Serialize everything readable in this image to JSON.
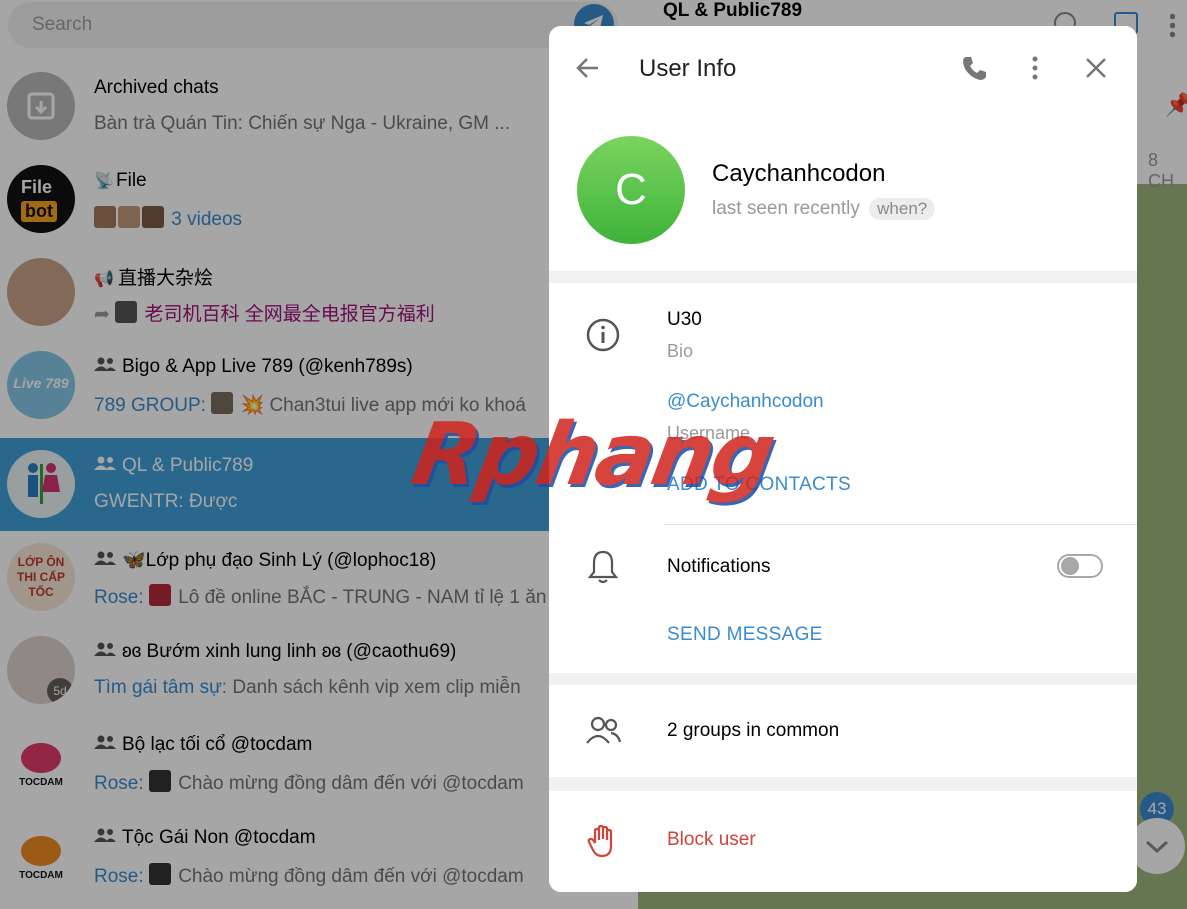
{
  "search": {
    "placeholder": "Search"
  },
  "chats": [
    {
      "title": "Archived chats",
      "subtitle": "Bàn trà Quán Tin: Chiến sự Nga - Ukraine, GM ...",
      "avatar": "archive-icon"
    },
    {
      "title": "File",
      "title_prefix_icon": "channel-icon",
      "subtitle": "3 videos",
      "avatar_text": [
        "File",
        "bot"
      ]
    },
    {
      "title": "直播大杂烩",
      "title_prefix_icon": "megaphone-icon",
      "subtitle": "老司机百科 全网最全电报官方福利"
    },
    {
      "title": "Bigo & App Live 789 (@kenh789s)",
      "sender": "789 GROUP:",
      "subtitle": "Chan3tui live app mới ko khoá",
      "avatar_text": [
        "Live 789"
      ]
    },
    {
      "title": "QL & Public789",
      "sender": "GWENTR:",
      "subtitle": "Được",
      "active": true
    },
    {
      "title": "🦋Lớp phụ đạo Sinh Lý (@lophoc18)",
      "sender": "Rose:",
      "subtitle": "Lô đề online BẮC - TRUNG - NAM tỉ lệ 1 ăn",
      "avatar_text": [
        "LỚP ÔN",
        "THI CẤP",
        "TỐC"
      ]
    },
    {
      "title": "ʚɞ Bướm xinh lung linh ʚɞ (@caothu69)",
      "sender": "Tìm gái tâm sự:",
      "subtitle": "Danh sách kênh vip xem clip miễn",
      "avatar_badge": "5d"
    },
    {
      "title": "Bộ lạc tối cổ @tocdam",
      "sender": "Rose:",
      "subtitle": "Chào mừng đồng dâm đến với @tocdam",
      "avatar_text": [
        "TOCDAM"
      ]
    },
    {
      "title": "Tộc Gái Non @tocdam",
      "sender": "Rose:",
      "subtitle": "Chào mừng đồng dâm đến với @tocdam",
      "avatar_text": [
        "TOCDAM"
      ]
    }
  ],
  "right_panel": {
    "title": "QL & Public789",
    "pinned_time": "8 CH",
    "unread_count": "43"
  },
  "modal": {
    "title": "User Info",
    "avatar_letter": "C",
    "name": "Caychanhcodon",
    "status": "last seen recently",
    "when_label": "when?",
    "bio_value": "U30",
    "bio_label": "Bio",
    "username_value": "@Caychanhcodon",
    "username_label": "Username",
    "add_contacts": "ADD TO CONTACTS",
    "notifications_label": "Notifications",
    "notifications_enabled": false,
    "send_message": "SEND MESSAGE",
    "groups_common": "2 groups in common",
    "block_user": "Block user"
  },
  "watermark": "Rphang",
  "colors": {
    "accent": "#3a8bd0",
    "active_chat": "#419fd9",
    "danger": "#d0453a",
    "avatar_green": "#4fc143"
  }
}
